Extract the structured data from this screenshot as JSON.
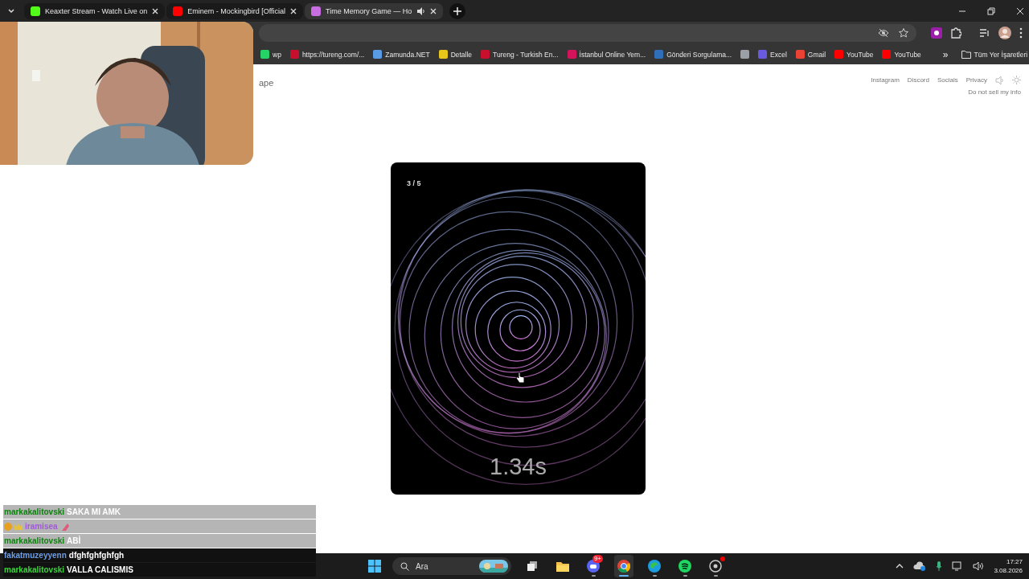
{
  "browser": {
    "tabs": [
      {
        "title": "Keaxter Stream - Watch Live on",
        "color": "#53fc18",
        "selected": false,
        "audio": false
      },
      {
        "title": "Eminem - Mockingbird [Official",
        "color": "#ff0000",
        "selected": false,
        "audio": false
      },
      {
        "title": "Time Memory Game — Ho",
        "color": "#c86ee0",
        "selected": true,
        "audio": true
      }
    ],
    "bookmarks": [
      {
        "label": "wp",
        "color": "#25d366"
      },
      {
        "label": "https://tureng.com/...",
        "color": "#c8102e"
      },
      {
        "label": "Zamunda.NET",
        "color": "#5a9be6"
      },
      {
        "label": "Detalle",
        "color": "#e8c61a"
      },
      {
        "label": "Tureng - Turkish En...",
        "color": "#c8102e"
      },
      {
        "label": "İstanbul Online Yem...",
        "color": "#d4145a"
      },
      {
        "label": "Gönderi Sorgulama...",
        "color": "#2f6fb8"
      },
      {
        "color": "#9aa0a6"
      },
      {
        "label": "Excel",
        "color": "#6a5ae0"
      },
      {
        "label": "Gmail",
        "color": "#ea4335"
      },
      {
        "label": "YouTube",
        "color": "#ff0000"
      },
      {
        "label": "YouTube",
        "color": "#ff0000"
      }
    ],
    "more": "»",
    "all_bookmarks": "Tüm Yer İşaretleri"
  },
  "page": {
    "site_title": "ape",
    "nav_links": [
      "Instagram",
      "Discord",
      "Socials",
      "Privacy"
    ],
    "footer_link": "Do not sell my info",
    "game": {
      "counter": "3 / 5",
      "time": "1.34s"
    }
  },
  "chat": [
    {
      "user": "markakalitovski",
      "message": "SAKA MI AMK",
      "color": "#0d800d",
      "highlighted": true,
      "kind": "text"
    },
    {
      "user": "iramisea",
      "color": "#a259d9",
      "highlighted": true,
      "kind": "emote"
    },
    {
      "user": "markakalitovski",
      "message": "ABİ",
      "color": "#0d800d",
      "highlighted": true,
      "kind": "text"
    },
    {
      "user": "fakatmuzeyyenn",
      "message": "dfghfghfghfgh",
      "color": "#6f9ee8",
      "highlighted": false,
      "kind": "text"
    },
    {
      "user": "markakalitovski",
      "message": "VALLA CALISMIS",
      "color": "#3fd43f",
      "highlighted": false,
      "kind": "text"
    }
  ],
  "taskbar": {
    "search_placeholder": "Ara",
    "apps": [
      {
        "kind": "task-view",
        "running": false,
        "selected": false
      },
      {
        "kind": "folder",
        "running": false,
        "selected": false
      },
      {
        "kind": "chat",
        "running": true,
        "selected": false,
        "badge": "9+"
      },
      {
        "kind": "browser",
        "running": true,
        "selected": true
      },
      {
        "kind": "edge",
        "running": true,
        "selected": false
      },
      {
        "kind": "music",
        "running": true,
        "selected": false
      },
      {
        "kind": "recorder",
        "running": true,
        "selected": false,
        "alert": true
      }
    ],
    "time": "17:27",
    "date": "3.08.2026"
  }
}
